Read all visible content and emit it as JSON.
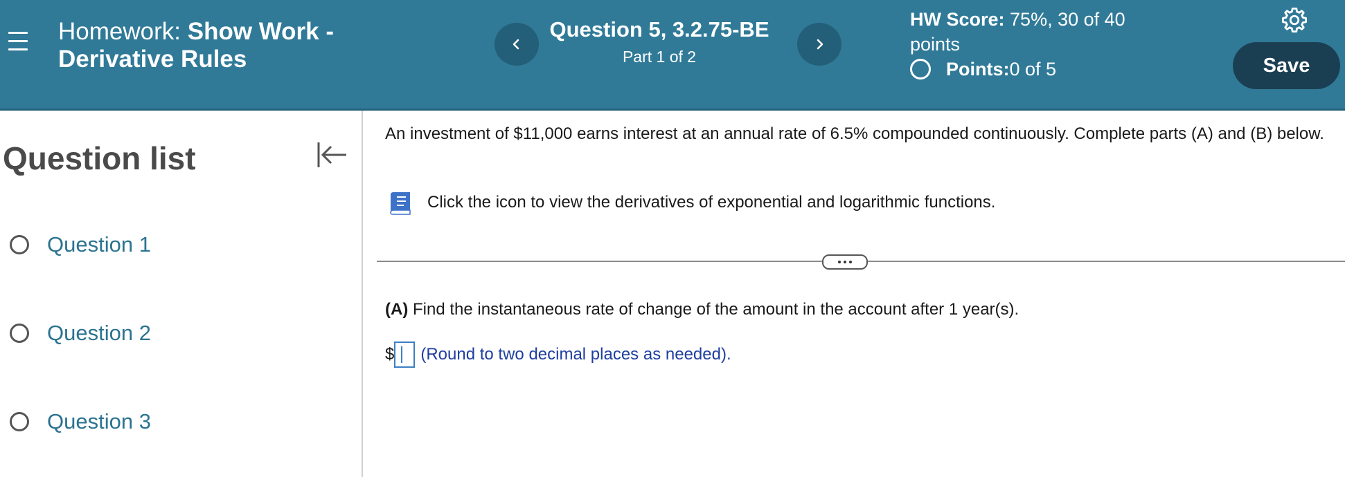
{
  "header": {
    "homework_prefix": "Homework: ",
    "homework_title_bold": "Show Work - Derivative Rules",
    "question_title": "Question 5, 3.2.75-BE",
    "question_part": "Part 1 of 2",
    "hw_score_label": "HW Score:",
    "hw_score_value": " 75%, 30 of 40 points",
    "points_label": "Points:",
    "points_value": " 0 of 5",
    "save_label": "Save",
    "prev_icon": "chevron-left-icon",
    "next_icon": "chevron-right-icon",
    "settings_icon": "gear-icon",
    "menu_icon": "hamburger-menu-icon",
    "colors": {
      "header_bg": "#307a98",
      "nav_button_bg": "#235f78",
      "save_bg": "#1b3f52",
      "question_link": "#2b7390",
      "hint_text": "#1f3fa0"
    }
  },
  "sidebar": {
    "title": "Question list",
    "collapse_icon": "collapse-left-icon",
    "questions": [
      {
        "label": "Question 1"
      },
      {
        "label": "Question 2"
      },
      {
        "label": "Question 3"
      }
    ]
  },
  "main": {
    "problem_text": "An investment of $11,000 earns interest at an annual rate of 6.5% compounded continuously. Complete parts (A) and (B) below.",
    "derivatives_link_text": "Click the icon to view the derivatives of exponential and logarithmic functions.",
    "book_icon": "book-icon",
    "part_a_label": "(A)",
    "part_a_text": " Find the instantaneous rate of change of the amount in the account after 1 year(s).",
    "currency_symbol": "$",
    "answer_value": "",
    "answer_hint": "(Round to two decimal places as needed)."
  }
}
